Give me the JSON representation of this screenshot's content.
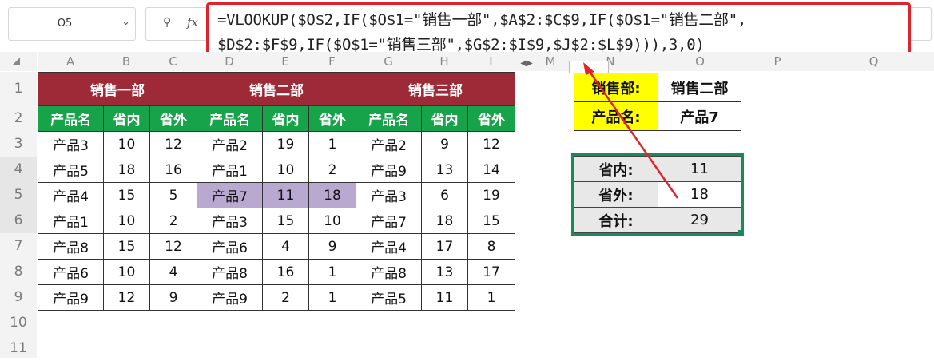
{
  "formula_bar": {
    "cell_ref": "O5",
    "fx_label": "fx",
    "formula_line1": "=VLOOKUP($O$2,IF($O$1=\"销售一部\",$A$2:$C$9,IF($O$1=\"销售二部\",",
    "formula_line2": "$D$2:$F$9,IF($O$1=\"销售三部\",$G$2:$I$9,$J$2:$L$9))),3,0)"
  },
  "columns": [
    "A",
    "B",
    "C",
    "D",
    "E",
    "F",
    "G",
    "H",
    "I",
    "M",
    "N",
    "O",
    "P",
    "Q"
  ],
  "rows": [
    "1",
    "2",
    "3",
    "4",
    "5",
    "6",
    "7",
    "8",
    "9",
    "10",
    "11"
  ],
  "table": {
    "titles": [
      "销售一部",
      "销售二部",
      "销售三部"
    ],
    "headers": [
      "产品名",
      "省内",
      "省外",
      "产品名",
      "省内",
      "省外",
      "产品名",
      "省内",
      "省外"
    ],
    "rows": [
      [
        "产品3",
        "10",
        "12",
        "产品2",
        "19",
        "1",
        "产品2",
        "9",
        "12"
      ],
      [
        "产品5",
        "18",
        "16",
        "产品1",
        "10",
        "2",
        "产品9",
        "13",
        "14"
      ],
      [
        "产品4",
        "15",
        "5",
        "产品7",
        "11",
        "18",
        "产品3",
        "6",
        "19"
      ],
      [
        "产品1",
        "10",
        "2",
        "产品3",
        "15",
        "10",
        "产品7",
        "18",
        "15"
      ],
      [
        "产品8",
        "15",
        "12",
        "产品6",
        "4",
        "9",
        "产品4",
        "17",
        "8"
      ],
      [
        "产品6",
        "10",
        "4",
        "产品8",
        "16",
        "1",
        "产品8",
        "13",
        "17"
      ],
      [
        "产品9",
        "12",
        "9",
        "产品9",
        "2",
        "1",
        "产品5",
        "11",
        "1"
      ]
    ]
  },
  "lookup": {
    "dept_label": "销售部:",
    "dept_value": "销售二部",
    "product_label": "产品名:",
    "product_value": "产品7"
  },
  "result": {
    "domestic_label": "省内:",
    "domestic_value": "11",
    "foreign_label": "省外:",
    "foreign_value": "18",
    "total_label": "合计:",
    "total_value": "29"
  },
  "colors": {
    "title_bg": "#9e2a38",
    "header_bg": "#17a34a",
    "highlight": "#b9a9d0",
    "yellow": "#ffff00",
    "annotation": "#e0242d"
  }
}
